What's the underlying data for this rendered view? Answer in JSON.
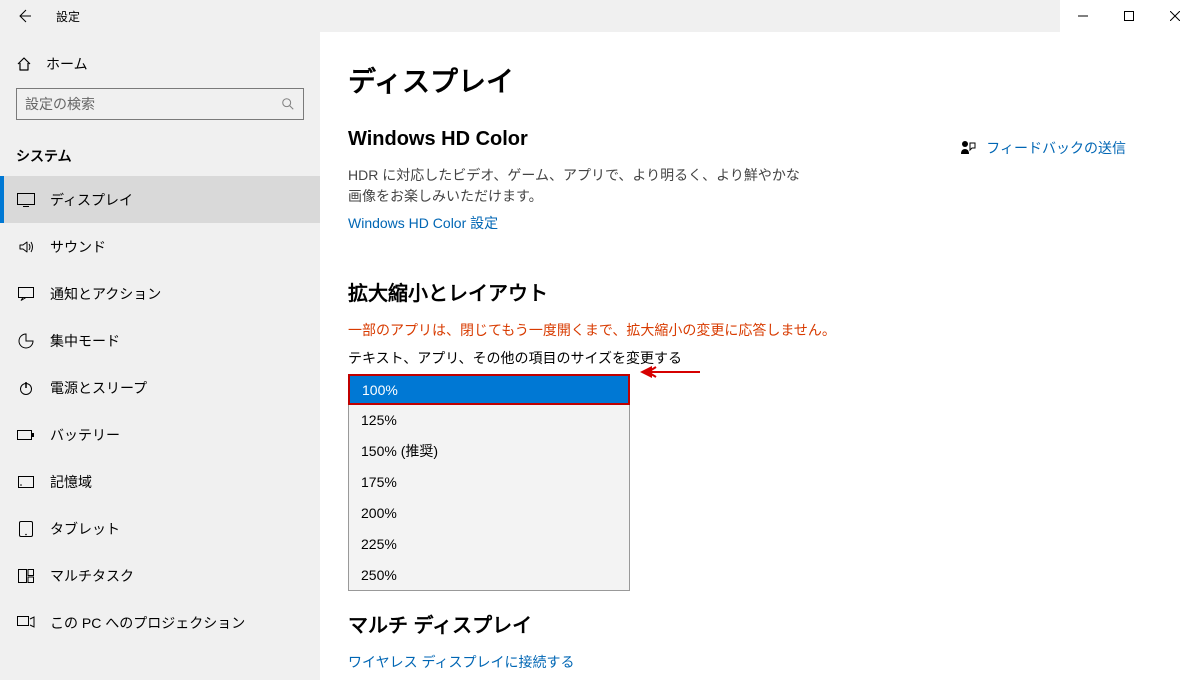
{
  "window": {
    "title": "設定"
  },
  "sidebar": {
    "home_label": "ホーム",
    "search_placeholder": "設定の検索",
    "section_label": "システム",
    "items": [
      {
        "label": "ディスプレイ",
        "active": true
      },
      {
        "label": "サウンド",
        "active": false
      },
      {
        "label": "通知とアクション",
        "active": false
      },
      {
        "label": "集中モード",
        "active": false
      },
      {
        "label": "電源とスリープ",
        "active": false
      },
      {
        "label": "バッテリー",
        "active": false
      },
      {
        "label": "記憶域",
        "active": false
      },
      {
        "label": "タブレット",
        "active": false
      },
      {
        "label": "マルチタスク",
        "active": false
      },
      {
        "label": "この PC へのプロジェクション",
        "active": false
      }
    ]
  },
  "main": {
    "feedback_label": "フィードバックの送信",
    "page_title": "ディスプレイ",
    "hdcolor": {
      "heading": "Windows HD Color",
      "desc": "HDR に対応したビデオ、ゲーム、アプリで、より明るく、より鮮やかな画像をお楽しみいただけます。",
      "link": "Windows HD Color 設定"
    },
    "scale": {
      "heading": "拡大縮小とレイアウト",
      "warning": "一部のアプリは、閉じてもう一度開くまで、拡大縮小の変更に応答しません。",
      "label": "テキスト、アプリ、その他の項目のサイズを変更する",
      "options": [
        "100%",
        "125%",
        "150% (推奨)",
        "175%",
        "200%",
        "225%",
        "250%"
      ],
      "selected": "100%"
    },
    "multidisplay": {
      "heading": "マルチ ディスプレイ",
      "link": "ワイヤレス ディスプレイに接続する"
    }
  },
  "annotation": {
    "color": "#d60000"
  }
}
